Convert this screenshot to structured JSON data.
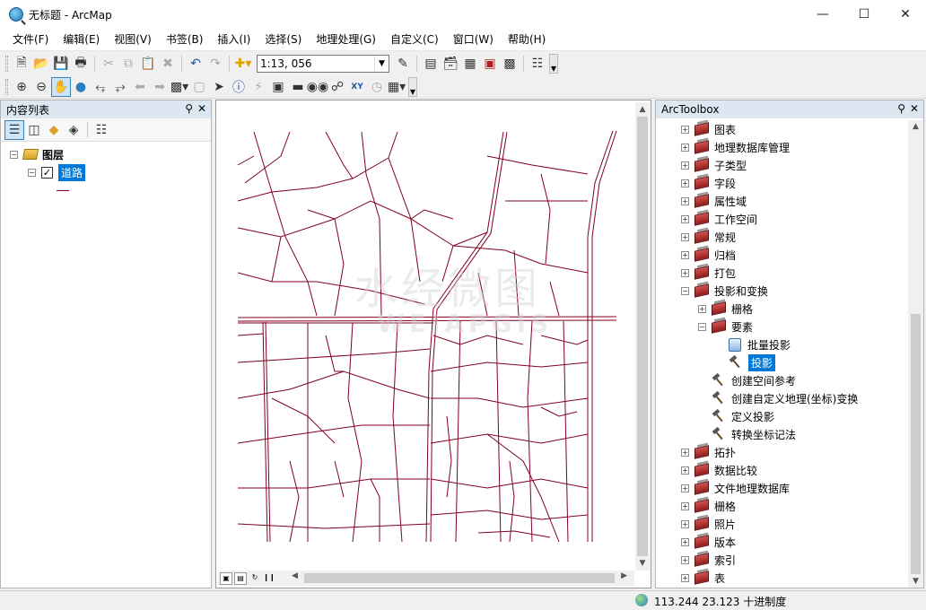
{
  "window": {
    "title": "无标题 - ArcMap"
  },
  "menu": [
    "文件(F)",
    "编辑(E)",
    "视图(V)",
    "书签(B)",
    "插入(I)",
    "选择(S)",
    "地理处理(G)",
    "自定义(C)",
    "窗口(W)",
    "帮助(H)"
  ],
  "toolbar": {
    "scale": "1:13, 056"
  },
  "toc": {
    "title": "内容列表",
    "root_label": "图层",
    "layer_label": "道路"
  },
  "map": {
    "road_color": "#800020",
    "watermark_cn": "水经微图",
    "watermark_en": "WEIAPGIS"
  },
  "toolbox": {
    "title": "ArcToolbox",
    "items": [
      {
        "label": "图表",
        "level": 0,
        "kind": "box",
        "expander": "+"
      },
      {
        "label": "地理数据库管理",
        "level": 0,
        "kind": "box",
        "expander": "+"
      },
      {
        "label": "子类型",
        "level": 0,
        "kind": "box",
        "expander": "+"
      },
      {
        "label": "字段",
        "level": 0,
        "kind": "box",
        "expander": "+"
      },
      {
        "label": "属性域",
        "level": 0,
        "kind": "box",
        "expander": "+"
      },
      {
        "label": "工作空间",
        "level": 0,
        "kind": "box",
        "expander": "+"
      },
      {
        "label": "常规",
        "level": 0,
        "kind": "box",
        "expander": "+"
      },
      {
        "label": "归档",
        "level": 0,
        "kind": "box",
        "expander": "+"
      },
      {
        "label": "打包",
        "level": 0,
        "kind": "box",
        "expander": "+"
      },
      {
        "label": "投影和变换",
        "level": 0,
        "kind": "box",
        "expander": "-"
      },
      {
        "label": "栅格",
        "level": 1,
        "kind": "box",
        "expander": "+"
      },
      {
        "label": "要素",
        "level": 1,
        "kind": "box",
        "expander": "-"
      },
      {
        "label": "批量投影",
        "level": 2,
        "kind": "script",
        "expander": ""
      },
      {
        "label": "投影",
        "level": 2,
        "kind": "hammer",
        "expander": "",
        "selected": true
      },
      {
        "label": "创建空间参考",
        "level": 1,
        "kind": "hammer",
        "expander": ""
      },
      {
        "label": "创建自定义地理(坐标)变换",
        "level": 1,
        "kind": "hammer",
        "expander": ""
      },
      {
        "label": "定义投影",
        "level": 1,
        "kind": "hammer",
        "expander": ""
      },
      {
        "label": "转换坐标记法",
        "level": 1,
        "kind": "hammer",
        "expander": ""
      },
      {
        "label": "拓扑",
        "level": 0,
        "kind": "box",
        "expander": "+"
      },
      {
        "label": "数据比较",
        "level": 0,
        "kind": "box",
        "expander": "+"
      },
      {
        "label": "文件地理数据库",
        "level": 0,
        "kind": "box",
        "expander": "+"
      },
      {
        "label": "栅格",
        "level": 0,
        "kind": "box",
        "expander": "+"
      },
      {
        "label": "照片",
        "level": 0,
        "kind": "box",
        "expander": "+"
      },
      {
        "label": "版本",
        "level": 0,
        "kind": "box",
        "expander": "+"
      },
      {
        "label": "索引",
        "level": 0,
        "kind": "box",
        "expander": "+"
      },
      {
        "label": "表",
        "level": 0,
        "kind": "box",
        "expander": "+"
      }
    ]
  },
  "status": {
    "coords": "113.244  23.123 十进制度"
  }
}
